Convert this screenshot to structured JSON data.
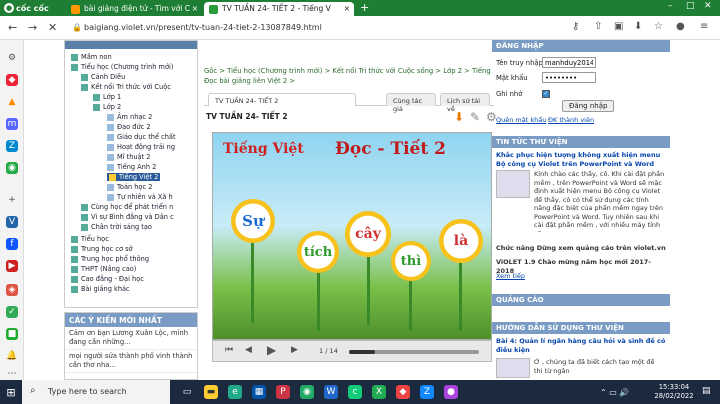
{
  "browser": {
    "brand": "cốc cốc",
    "tabs": [
      {
        "label": "bài giảng điện tử - Tìm với C"
      },
      {
        "label": "TV TUẦN 24- TIẾT 2 - Tiếng V"
      }
    ],
    "url": "baigiang.violet.vn/present/tv-tuan-24-tiet-2-13087849.html"
  },
  "tree": {
    "items": [
      {
        "label": "Mầm non"
      },
      {
        "label": "Tiểu học (Chương trình mới)"
      },
      {
        "label": "Cánh Diều"
      },
      {
        "label": "Kết nối Tri thức với Cuộc"
      },
      {
        "label": "Lớp 1"
      },
      {
        "label": "Lớp 2"
      },
      {
        "label": "Âm nhạc 2"
      },
      {
        "label": "Đạo đức 2"
      },
      {
        "label": "Giáo dục thể chất"
      },
      {
        "label": "Hoạt động trải ng"
      },
      {
        "label": "Mĩ thuật 2"
      },
      {
        "label": "Tiếng Anh 2"
      },
      {
        "label": "Tiếng Việt 2"
      },
      {
        "label": "Toán học 2"
      },
      {
        "label": "Tự nhiên và Xã h"
      },
      {
        "label": "Cùng học để phát triển n"
      },
      {
        "label": "Vì sự Bình đẳng và Dân c"
      },
      {
        "label": "Chân trời sáng tạo"
      },
      {
        "label": "Tiểu học"
      },
      {
        "label": "Trung học cơ sở"
      },
      {
        "label": "Trung học phổ thông"
      },
      {
        "label": "THPT (Nâng cao)"
      },
      {
        "label": "Cao đẳng - Đại học"
      },
      {
        "label": "Bài giảng khác"
      }
    ]
  },
  "comments": {
    "title": "CÁC Ý KIẾN MỚI NHẤT",
    "items": [
      {
        "text": "Cảm ơn bạn Lương Xuân Lộc, mình đang cần những..."
      },
      {
        "text": "mọi người sửa thành phố vinh thành cần thơ nha..."
      }
    ]
  },
  "breadcrumb": "Gốc > Tiểu học (Chương trình mới) > Kết nối Tri thức với Cuộc sống > Lớp 2 > Tiếng Đọc bài giảng liên Việt 2 >",
  "content_tabs": [
    "TV TUẦN 24- TIẾT 2",
    "Cùng tác giả",
    "Lịch sử tải về"
  ],
  "lesson_title": "TV TUẦN 24- TIẾT 2",
  "slide": {
    "subject": "Tiếng Việt",
    "heading": "Đọc - Tiết 2",
    "words": [
      "Sự",
      "tích",
      "cây",
      "thì",
      "là"
    ],
    "page": "1 / 14",
    "progress": 0.2
  },
  "login": {
    "title": "ĐĂNG NHẬP",
    "user_label": "Tên truy nhập",
    "user_value": "manhduy2014",
    "pass_label": "Mật khẩu",
    "pass_value": "••••••••",
    "remember_label": "Ghi nhớ",
    "submit": "Đăng nhập",
    "forgot": "Quên mật khẩu",
    "register": "ĐK thành viên"
  },
  "news": {
    "title": "TIN TỨC THƯ VIỆN",
    "headline": "Khắc phục hiện tượng không xuất hiện menu Bộ công cụ Violet trên PowerPoint và Word",
    "body": "Kính chào các thầy, cô. Khi cài đặt phần mềm , trên PowerPoint và Word sẽ mặc định xuất hiện menu Bộ công cụ Violet để thầy, cô có thể sử dụng các tính năng đặc biệt của phần mềm ngay trên PowerPoint và Word. Tuy nhiên sau khi cài đặt phần mềm , với nhiều máy tính sẽ...",
    "item2": "Chức năng Dừng xem quảng cáo trên violet.vn",
    "item3": "ViOLET 1.9 Chào mừng năm học mới 2017-2018",
    "more": "Xem tiếp"
  },
  "ads_title": "QUẢNG CÁO",
  "guide": {
    "title": "HƯỚNG DẪN SỬ DỤNG THƯ VIỆN",
    "headline": "Bài 4: Quản lí ngân hàng câu hỏi và sinh đề có điều kiện",
    "body": "Ở , chúng ta đã biết cách tạo một đề thi từ ngân"
  },
  "taskbar": {
    "search": "Type here to search",
    "time": "15:33:04",
    "date": "28/02/2022"
  }
}
